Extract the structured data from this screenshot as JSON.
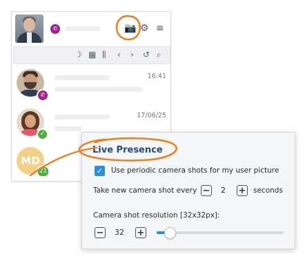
{
  "accent_color": "#f07f1e",
  "topbar": {
    "icons": [
      "phone-icon",
      "camera-icon",
      "gear-icon",
      "menu-icon"
    ]
  },
  "toolbar": {
    "icons": [
      "smiley-clock-icon",
      "calendar-icon",
      "columns-icon",
      "chevron-left-icon",
      "chevron-right-icon",
      "history-icon",
      "search-icon"
    ]
  },
  "conversations": [
    {
      "time": "16:41",
      "status": "phone"
    },
    {
      "time": "17/06/25",
      "status": "available"
    },
    {
      "initials": "MD",
      "badge": "21"
    }
  ],
  "popup": {
    "title": "Live Presence",
    "checkbox_label": "Use periodic camera shots for my user picture",
    "checkbox_checked": true,
    "interval_prefix": "Take new camera shot every",
    "interval_value": "2",
    "interval_suffix": "seconds",
    "resolution_label": "Camera shot resolution [32x32px]:",
    "resolution_value": "32",
    "resolution_slider_fraction": 0.1
  }
}
